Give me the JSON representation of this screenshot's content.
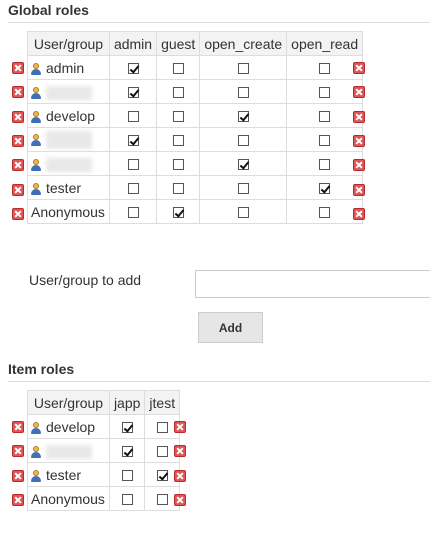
{
  "global_roles": {
    "title": "Global roles",
    "columns": [
      "User/group",
      "admin",
      "guest",
      "open_create",
      "open_read"
    ],
    "rows": [
      {
        "name": "admin",
        "icon": "user-icon",
        "checks": [
          true,
          false,
          false,
          false
        ]
      },
      {
        "name": "",
        "icon": "user-icon",
        "checks": [
          true,
          false,
          false,
          false
        ]
      },
      {
        "name": "develop",
        "icon": "user-icon",
        "checks": [
          false,
          false,
          true,
          false
        ]
      },
      {
        "name": "",
        "icon": "user-icon",
        "checks": [
          true,
          false,
          false,
          false
        ]
      },
      {
        "name": "",
        "icon": "user-icon",
        "checks": [
          false,
          false,
          true,
          false
        ]
      },
      {
        "name": "tester",
        "icon": "user-icon",
        "checks": [
          false,
          false,
          false,
          true
        ]
      },
      {
        "name": "Anonymous",
        "icon": "",
        "checks": [
          false,
          true,
          false,
          false
        ]
      }
    ]
  },
  "add_user": {
    "label": "User/group to add",
    "value": "",
    "button_label": "Add"
  },
  "item_roles": {
    "title": "Item roles",
    "columns": [
      "User/group",
      "japp",
      "jtest"
    ],
    "rows": [
      {
        "name": "develop",
        "icon": "user-icon",
        "checks": [
          true,
          false
        ]
      },
      {
        "name": "",
        "icon": "user-icon",
        "checks": [
          true,
          false
        ]
      },
      {
        "name": "tester",
        "icon": "user-icon",
        "checks": [
          false,
          true
        ]
      },
      {
        "name": "Anonymous",
        "icon": "",
        "checks": [
          false,
          false
        ]
      }
    ]
  },
  "colors": {
    "delete": "#e05555",
    "header_bg": "#f3f3f3",
    "border": "#dddddd"
  }
}
